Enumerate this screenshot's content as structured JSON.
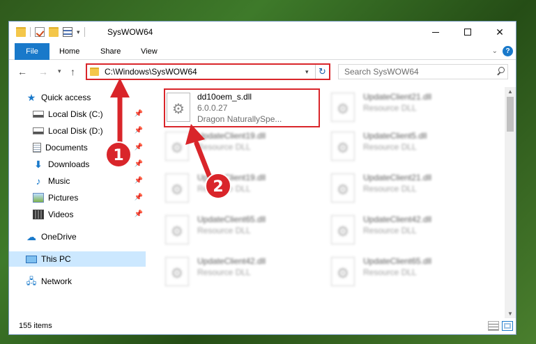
{
  "window": {
    "title": "SysWOW64",
    "buttons": {
      "minimize": "—",
      "maximize": "",
      "close": "✕"
    }
  },
  "ribbon": {
    "tabs": [
      {
        "label": "File"
      },
      {
        "label": "Home"
      },
      {
        "label": "Share"
      },
      {
        "label": "View"
      }
    ],
    "help": "?"
  },
  "navigation": {
    "back": "←",
    "forward": "→",
    "recent": "▾",
    "up": "↑",
    "address": "C:\\Windows\\SysWOW64",
    "address_dropdown": "▾",
    "refresh": "↻",
    "search_placeholder": "Search SysWOW64"
  },
  "sidebar": {
    "items": [
      {
        "label": "Quick access",
        "icon": "star-icon",
        "pinned": false
      },
      {
        "label": "Local Disk (C:)",
        "icon": "disk-icon",
        "pinned": true
      },
      {
        "label": "Local Disk (D:)",
        "icon": "disk-icon",
        "pinned": true
      },
      {
        "label": "Documents",
        "icon": "documents-icon",
        "pinned": true
      },
      {
        "label": "Downloads",
        "icon": "downloads-icon",
        "pinned": true
      },
      {
        "label": "Music",
        "icon": "music-icon",
        "pinned": true
      },
      {
        "label": "Pictures",
        "icon": "pictures-icon",
        "pinned": true
      },
      {
        "label": "Videos",
        "icon": "videos-icon",
        "pinned": true
      },
      {
        "label": "OneDrive",
        "icon": "onedrive-icon",
        "pinned": false
      },
      {
        "label": "This PC",
        "icon": "this-pc-icon",
        "pinned": false,
        "selected": true
      },
      {
        "label": "Network",
        "icon": "network-icon",
        "pinned": false
      }
    ]
  },
  "files": [
    {
      "name": "dd10oem_s.dll",
      "line2": "6.0.0.27",
      "line3": "Dragon NaturallySpe...",
      "highlighted": true
    },
    {
      "name": "UpdateClient21.dll",
      "line2": "Resource DLL",
      "line3": "",
      "blurred": true
    },
    {
      "name": "UpdateClient19.dll",
      "line2": "Resource DLL",
      "line3": "",
      "blurred": true
    },
    {
      "name": "UpdateClient5.dll",
      "line2": "Resource DLL",
      "line3": "",
      "blurred": true
    },
    {
      "name": "UpdateClient19.dll",
      "line2": "Resource DLL",
      "line3": "",
      "blurred": true
    },
    {
      "name": "UpdateClient21.dll",
      "line2": "Resource DLL",
      "line3": "",
      "blurred": true
    },
    {
      "name": "UpdateClient65.dll",
      "line2": "Resource DLL",
      "line3": "",
      "blurred": true
    },
    {
      "name": "UpdateClient42.dll",
      "line2": "Resource DLL",
      "line3": "",
      "blurred": true
    },
    {
      "name": "UpdateClient42.dll",
      "line2": "Resource DLL",
      "line3": "",
      "blurred": true
    },
    {
      "name": "UpdateClient65.dll",
      "line2": "Resource DLL",
      "line3": "",
      "blurred": true
    }
  ],
  "status": {
    "count": "155 items"
  },
  "annotations": {
    "step1": "1",
    "step2": "2",
    "color": "#d9252a"
  },
  "colors": {
    "accent": "#1979ca",
    "highlight": "#d9252a",
    "selected": "#cce8ff"
  }
}
